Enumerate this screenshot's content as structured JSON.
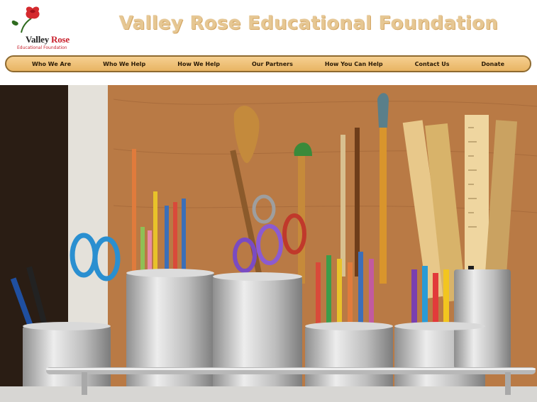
{
  "header": {
    "logo": {
      "line1a": "Valley ",
      "line1b": "Rose",
      "line2": "Educational Foundation"
    },
    "title": "Valley Rose Educational Foundation"
  },
  "nav": {
    "items": [
      {
        "label": "Who We Are"
      },
      {
        "label": "Who We Help"
      },
      {
        "label": "How We Help"
      },
      {
        "label": "Our Partners"
      },
      {
        "label": "How You Can Help"
      },
      {
        "label": "Contact Us"
      },
      {
        "label": "Donate"
      }
    ]
  },
  "hero": {
    "image_description": "art-supplies-photo",
    "colors": {
      "wall": "#b5733f",
      "metal": "#c9c9c9"
    }
  },
  "colors": {
    "nav_fill": "#f0c27a",
    "nav_border": "#8e6a2f",
    "title": "#e6c793",
    "brand_red": "#c8202c"
  }
}
